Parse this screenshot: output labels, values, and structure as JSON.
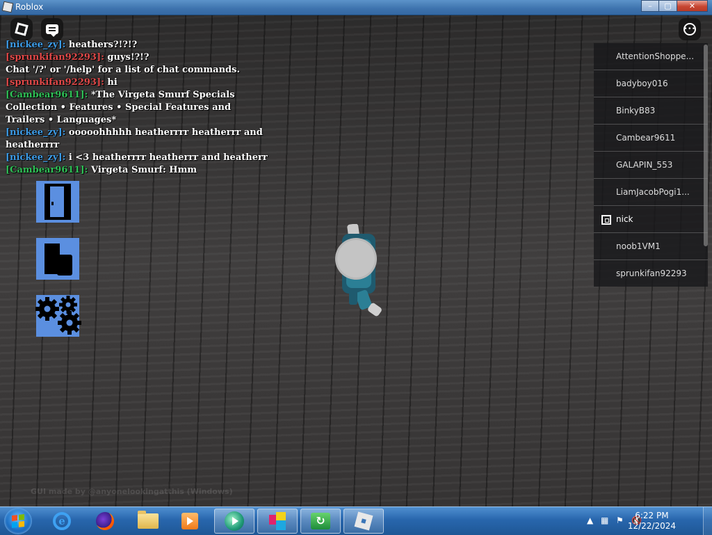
{
  "window": {
    "title": "Roblox",
    "minimize": "–",
    "maximize": "▢",
    "close": "✕"
  },
  "chat": [
    {
      "name": "[nickee_zy]:",
      "color": "blue",
      "text": " heathers?!?!?"
    },
    {
      "name": "[sprunkifan92293]:",
      "color": "red",
      "text": " guys!?!?"
    },
    {
      "name": "",
      "color": "",
      "text": "Chat '/?' or '/help' for a list of chat commands."
    },
    {
      "name": "[sprunkifan92293]:",
      "color": "red",
      "text": " hi"
    },
    {
      "name": "[Cambear9611]:",
      "color": "green",
      "text": " *The Virgeta Smurf Specials Collection • Features • Special Features and Trailers • Languages*"
    },
    {
      "name": "[nickee_zy]:",
      "color": "blue",
      "text": " ooooohhhhh heatherrrr heatherrr and heatherrrr"
    },
    {
      "name": "[nickee_zy]:",
      "color": "blue",
      "text": "  i <3 heatherrrr heatherrr and heatherr"
    },
    {
      "name": "[Cambear9611]:",
      "color": "green",
      "text": " Virgeta Smurf: Hmm"
    }
  ],
  "players": [
    "AttentionShoppe...",
    "badyboy016",
    "BinkyB83",
    "Cambear9611",
    "GALAPIN_553",
    "LiamJacobPogi1...",
    "nick",
    "noob1VM1",
    "sprunkifan92293"
  ],
  "watermark": "GUI made by @anyonelookingatthis (Windows)",
  "taskbar": {
    "clock_time": "6:22 PM",
    "clock_date": "12/22/2024"
  },
  "icons": {
    "roblox_menu": "roblox-logo-icon",
    "chat_toggle": "chat-icon",
    "more_menu": "more-options-icon",
    "exit": "door-icon",
    "avatar": "shirt-icon",
    "settings": "gears-icon"
  },
  "colors": {
    "name_blue": "#3c9be6",
    "name_red": "#e04848",
    "name_green": "#2fbf56",
    "side_button": "#5b8fe0"
  }
}
